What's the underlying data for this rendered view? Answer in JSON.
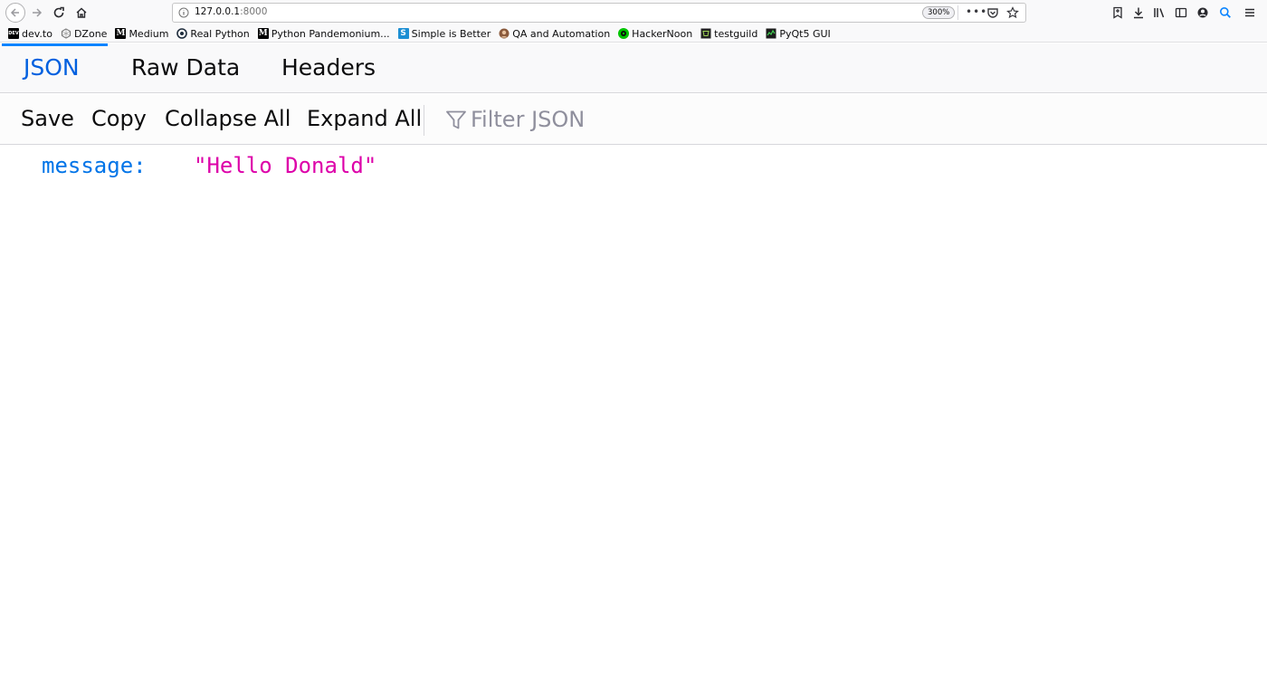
{
  "browser": {
    "url_host": "127.0.0.1",
    "url_port": ":8000",
    "zoom": "300%",
    "more_menu": "•••"
  },
  "bookmarks": [
    {
      "label": "dev.to",
      "icon": "devto-icon",
      "fav_text": "DEV",
      "color": "#000000"
    },
    {
      "label": "DZone",
      "icon": "dzone-icon",
      "fav_text": "",
      "color": "#ffffff"
    },
    {
      "label": "Medium",
      "icon": "medium-icon",
      "fav_text": "M",
      "color": "#000000"
    },
    {
      "label": "Real Python",
      "icon": "realpython-icon",
      "fav_text": "",
      "color": "#ffffff"
    },
    {
      "label": "Python Pandemonium...",
      "icon": "medium-icon",
      "fav_text": "M",
      "color": "#000000"
    },
    {
      "label": "Simple is Better",
      "icon": "simpleisbetter-icon",
      "fav_text": "S",
      "color": "#1d8fd3"
    },
    {
      "label": "QA and Automation",
      "icon": "qa-avatar-icon",
      "fav_text": "",
      "color": "#8a5a3c"
    },
    {
      "label": "HackerNoon",
      "icon": "hackernoon-icon",
      "fav_text": "",
      "color": "#00c400"
    },
    {
      "label": "testguild",
      "icon": "testguild-icon",
      "fav_text": "",
      "color": "#222222"
    },
    {
      "label": "PyQt5  GUI",
      "icon": "pyqt-icon",
      "fav_text": "",
      "color": "#1b1b1b"
    }
  ],
  "viewer": {
    "tabs": [
      {
        "label": "JSON",
        "active": true
      },
      {
        "label": "Raw Data",
        "active": false
      },
      {
        "label": "Headers",
        "active": false
      }
    ],
    "toolbar": {
      "save": "Save",
      "copy": "Copy",
      "collapse_all": "Collapse All",
      "expand_all": "Expand All",
      "filter_placeholder": "Filter JSON"
    },
    "json": [
      {
        "key": "message:",
        "value": "\"Hello Donald\""
      }
    ]
  },
  "colors": {
    "accent": "#0a84ff",
    "json_key": "#0074e8",
    "json_string": "#dd00a9"
  }
}
